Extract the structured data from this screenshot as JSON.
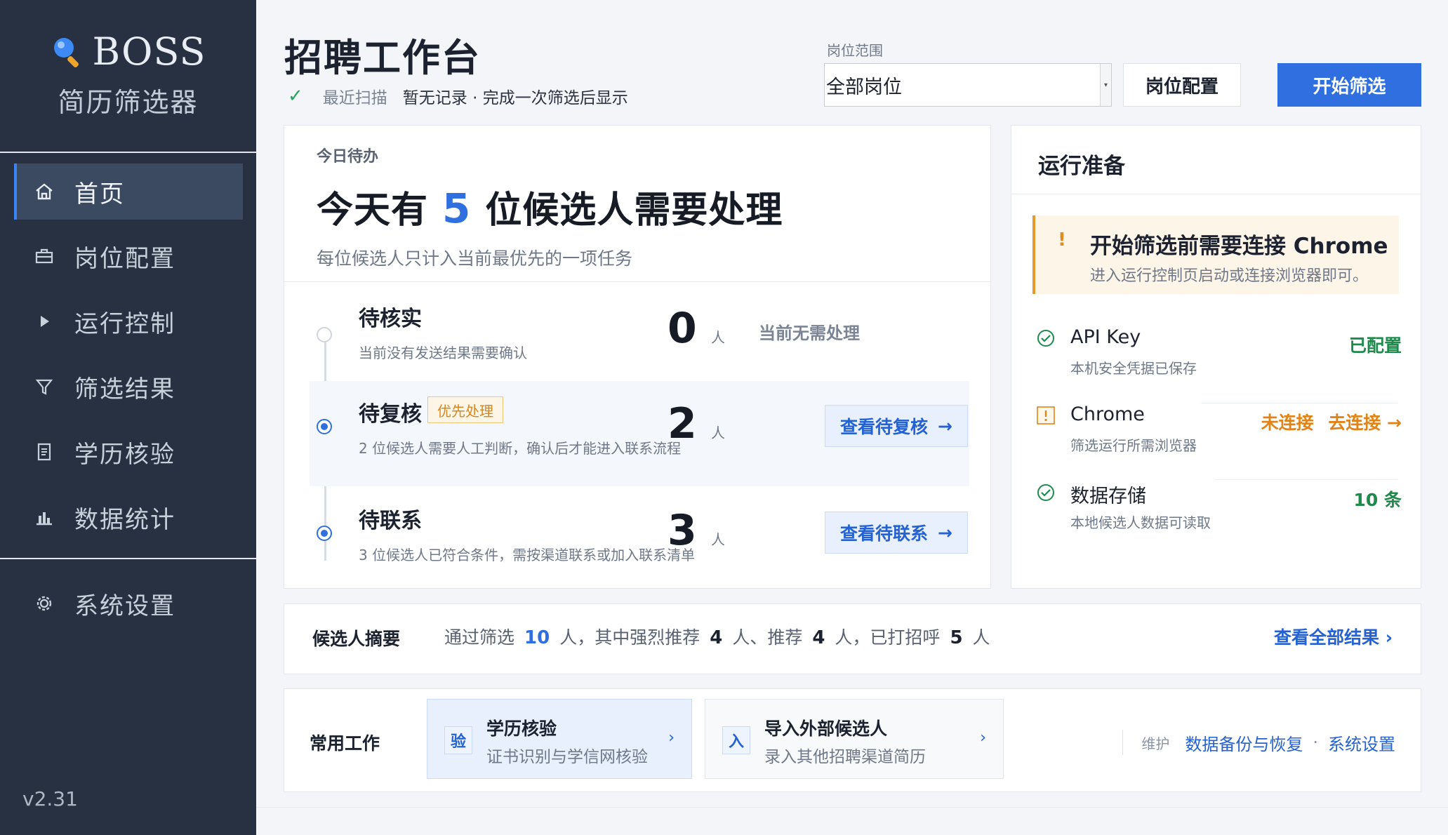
{
  "app": {
    "brand": "BOSS",
    "subtitle": "简历筛选器",
    "version": "v2.31"
  },
  "sidebar": {
    "items": [
      {
        "label": "首页",
        "icon": "home-icon",
        "active": true
      },
      {
        "label": "岗位配置",
        "icon": "briefcase-icon",
        "active": false
      },
      {
        "label": "运行控制",
        "icon": "play-icon",
        "active": false
      },
      {
        "label": "筛选结果",
        "icon": "filter-icon",
        "active": false
      },
      {
        "label": "学历核验",
        "icon": "document-icon",
        "active": false
      },
      {
        "label": "数据统计",
        "icon": "bar-chart-icon",
        "active": false
      }
    ],
    "settings": {
      "label": "系统设置",
      "icon": "gear-icon"
    }
  },
  "header": {
    "title": "招聘工作台",
    "scan_label": "最近扫描",
    "scan_value": "暂无记录 · 完成一次筛选后显示",
    "range_label": "岗位范围",
    "range_value": "全部岗位",
    "config_button": "岗位配置",
    "start_button": "开始筛选"
  },
  "todo": {
    "kicker": "今日待办",
    "headline_pre": "今天有",
    "headline_num": "5",
    "headline_post": "位候选人需要处理",
    "subtitle": "每位候选人只计入当前最优先的一项任务",
    "rows": [
      {
        "title": "待核实",
        "desc": "当前没有发送结果需要确认",
        "count": "0",
        "unit": "人",
        "status": "当前无需处理"
      },
      {
        "title": "待复核",
        "badge": "优先处理",
        "desc": "2 位候选人需要人工判断，确认后才能进入联系流程",
        "count": "2",
        "unit": "人",
        "button": "查看待复核",
        "arrow": "→"
      },
      {
        "title": "待联系",
        "desc": "3 位候选人已符合条件，需按渠道联系或加入联系清单",
        "count": "3",
        "unit": "人",
        "button": "查看待联系",
        "arrow": "→"
      }
    ]
  },
  "readiness": {
    "title": "运行准备",
    "alert_title": "开始筛选前需要连接 Chrome",
    "alert_desc": "进入运行控制页启动或连接浏览器即可。",
    "items": [
      {
        "name": "API Key",
        "desc": "本机安全凭据已保存",
        "status": "已配置",
        "icon": "check-circle-icon"
      },
      {
        "name": "Chrome",
        "desc": "筛选运行所需浏览器",
        "status": "未连接",
        "action": "去连接 →",
        "icon": "warning-icon"
      },
      {
        "name": "数据存储",
        "desc": "本地候选人数据可读取",
        "status": "10 条",
        "icon": "check-circle-icon"
      }
    ]
  },
  "summary": {
    "title": "候选人摘要",
    "t1": "通过筛选",
    "n1": "10",
    "t2": "人，其中强烈推荐",
    "n2": "4",
    "t3": "人、推荐",
    "n3": "4",
    "t4": "人，已打招呼",
    "n4": "5",
    "t5": "人",
    "link": "查看全部结果 ›"
  },
  "common": {
    "title": "常用工作",
    "tiles": [
      {
        "icon_text": "验",
        "name": "学历核验",
        "desc": "证书识别与学信网核验",
        "chev": "›"
      },
      {
        "icon_text": "入",
        "name": "导入外部候选人",
        "desc": "录入其他招聘渠道简历",
        "chev": "›"
      }
    ],
    "maint_label": "维护",
    "link1": "数据备份与恢复",
    "dot": "·",
    "link2": "系统设置"
  },
  "colors": {
    "sidebar_bg": "#273142",
    "accent": "#2f6fe0",
    "success": "#1e8a4b",
    "warning": "#e0841a"
  }
}
